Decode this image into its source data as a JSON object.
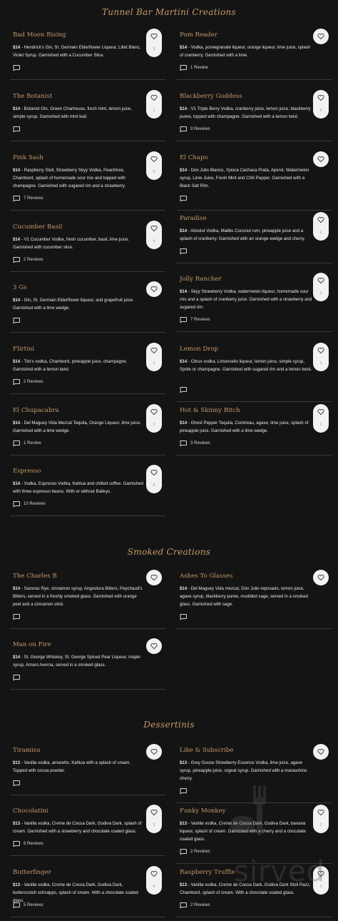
{
  "sections": [
    {
      "title": "Tunnel Bar Martini Creations"
    },
    {
      "title": "Smoked Creations"
    },
    {
      "title": "Dessertinis"
    }
  ],
  "items": [
    {
      "name": "Bad Moon Rising",
      "price": "$14",
      "desc": "Hendrick's Gin, St. Germain Elderflower Liqueur, Lillet Blanc, Violet Syrup. Garnished with a Cucumber Slice.",
      "reviews": "",
      "likes": "3"
    },
    {
      "name": "Pom Reader",
      "price": "$14",
      "desc": "Vodka, pomegranate liqueur, orange liqueur, lime juice, splash of cranberry. Garnished with a lime.",
      "reviews": "1 Review",
      "likes": ""
    },
    {
      "name": "The Botanist",
      "price": "$14",
      "desc": "Botanist Gin, Green Chartreuse, fresh mint, lemon juice, simple syrup. Garnished with mint leaf.",
      "reviews": "",
      "likes": "1"
    },
    {
      "name": "Blackberry Goddess",
      "price": "$14",
      "desc": "V1 Triple Berry Vodka, cranberry juice, lemon juice, blackberry puree, topped with champagne. Garnished with a lemon twist.",
      "reviews": "9 Reviews",
      "likes": "6"
    },
    {
      "name": "Pink Sash",
      "price": "$14",
      "desc": "Raspberry Stoli, Strawberry Skyy Vodka, Peachtree, Chambord, splash of homemade sour mix and topped with champagne. Garnished with sugared rim and a strawberry.",
      "reviews": "7 Reviews",
      "likes": "6"
    },
    {
      "name": "El Chapo",
      "price": "$14",
      "desc": "Don Julio Blanco, Ypioca Cachaca Prata, Aperol, Watermelon syrup, Lime Juice, Fresh Mint and Chili Pepper. Garnished with a Black Salt Rim.",
      "reviews": "",
      "likes": ""
    },
    {
      "name": "Cucumber Basil",
      "price": "$14",
      "desc": "V1 Cucumber Vodka, fresh cucumber, basil, lime juice. Garnished with cucumber slice.",
      "reviews": "2 Reviews",
      "likes": "4"
    },
    {
      "name": "Paradise",
      "price": "$14",
      "desc": "Absolut Vodka, Malibu Coconut rum, pineapple juice and a splash of cranberry. Garnished with an orange wedge and cherry.",
      "reviews": "",
      "likes": "1"
    },
    {
      "name": "3 Gs",
      "price": "$14",
      "desc": "Gin, St. Germain Elderflower liqueur, and grapefruit juice. Garnished with a lime wedge.",
      "reviews": "",
      "likes": ""
    },
    {
      "name": "Jolly Rancher",
      "price": "$14",
      "desc": "Skyy Strawberry Vodka, watermelon liqueur, homemade sour mix and a splash of cranberry juice. Garnished with a strawberry and sugared rim.",
      "reviews": "7 Reviews",
      "likes": "1"
    },
    {
      "name": "Flirtini",
      "price": "$14",
      "desc": "Tito's vodka, Chambord, pineapple juice, champagne. Garnished with a lemon twist.",
      "reviews": "2 Reviews",
      "likes": "1"
    },
    {
      "name": "Lemon Drop",
      "price": "$14",
      "desc": "Citrus vodka, Limoncello liqueur, lemon juice, simple syrup, Sprite or champagne. Garnished with sugared rim and a lemon twist.",
      "reviews": "",
      "likes": "1"
    },
    {
      "name": "El Chupacabra",
      "price": "$14",
      "desc": "Del Maguey Vida Mezcal Tequila, Orange Liqueur, lime juice. Garnished with a lime wedge.",
      "reviews": "1 Review",
      "likes": "2"
    },
    {
      "name": "Hot & Skinny Bitch",
      "price": "$14",
      "desc": "Ghost Pepper Tequila, Cointreau, agave, lime juice, splash of pineapple juice. Garnished with a lime wedge.",
      "reviews": "3 Reviews",
      "likes": "1"
    },
    {
      "name": "Espresso",
      "price": "$14",
      "desc": "Vodka, Espresso Vodka, Kahlua and chilled coffee. Garnished with three espresso beans. With or without Baileys.",
      "reviews": "10 Reviews",
      "likes": "4"
    },
    {
      "name": "The Charles B",
      "price": "$14",
      "desc": "Sazerac Rye, cinnamon syrup, Angostura Bitters, Peychaud's Bitters, served in a freshly smoked glass. Garnished with orange peel and a cinnamon stick.",
      "reviews": "",
      "likes": ""
    },
    {
      "name": "Ashes To Glasses",
      "price": "$14",
      "desc": "Del Maguey Vida mezcal, Don Julio reposado, lemon juice, agave syrup, blackberry purée, muddled sage, served in a smoked glass. Garnished with sage.",
      "reviews": "",
      "likes": ""
    },
    {
      "name": "Man on Fire",
      "price": "$14",
      "desc": "St. George Whiskey, St. George Spiced Pear Liqueur, maple syrup, Amaro Averna, served in a smoked glass.",
      "reviews": "",
      "likes": ""
    },
    {
      "name": "Tiramisu",
      "price": "$13",
      "desc": "Vanilla vodka, amaretto, Kahlua with a splash of cream. Topped with cocoa powder.",
      "reviews": "",
      "likes": ""
    },
    {
      "name": "Like & Subscribe",
      "price": "$13",
      "desc": "Grey Goose Strawberry Essence Vodka, lime juice, agave syrup, pineapple juice, orgeat syrup. Garnished with a maraschino cherry.",
      "reviews": "",
      "likes": ""
    },
    {
      "name": "Chocolatini",
      "price": "$13",
      "desc": "Vanilla vodka, Creme de Cocoa Dark, Godiva Dark, splash of cream. Garnished with a strawberry and chocolate coated glass.",
      "reviews": "8 Reviews",
      "likes": "3"
    },
    {
      "name": "Funky Monkey",
      "price": "$13",
      "desc": "Vanilla vodka, Creme de Cocoa Dark, Godiva Dark, banana liqueur, splash of cream. Garnished with a cherry and a chocolate coated glass.",
      "reviews": "2 Reviews",
      "likes": "2"
    },
    {
      "name": "Butterfinger",
      "price": "$13",
      "desc": "Vanilla vodka, Creme de Cocoa Dark, Godiva Dark, butterscotch schnapps, splash of cream. With a chocolate coated glass.",
      "reviews": "5 Reviews",
      "likes": "4"
    },
    {
      "name": "Raspberry Truffle",
      "price": "$13",
      "desc": "Vanilla vodka, Creme de Cocoa Dark, Godiva Dark Stoli Razz, Chambord, splash of cream. With a chocolate coated glass.",
      "reviews": "2 Reviews",
      "likes": "1"
    }
  ],
  "watermark": {
    "text": "sirved",
    "icon": "fork-spoon-icon"
  },
  "colors": {
    "background": "#141414",
    "accent": "#c79a6a",
    "text": "#e9e6e0",
    "heart_bg": "#f2f2f2"
  }
}
